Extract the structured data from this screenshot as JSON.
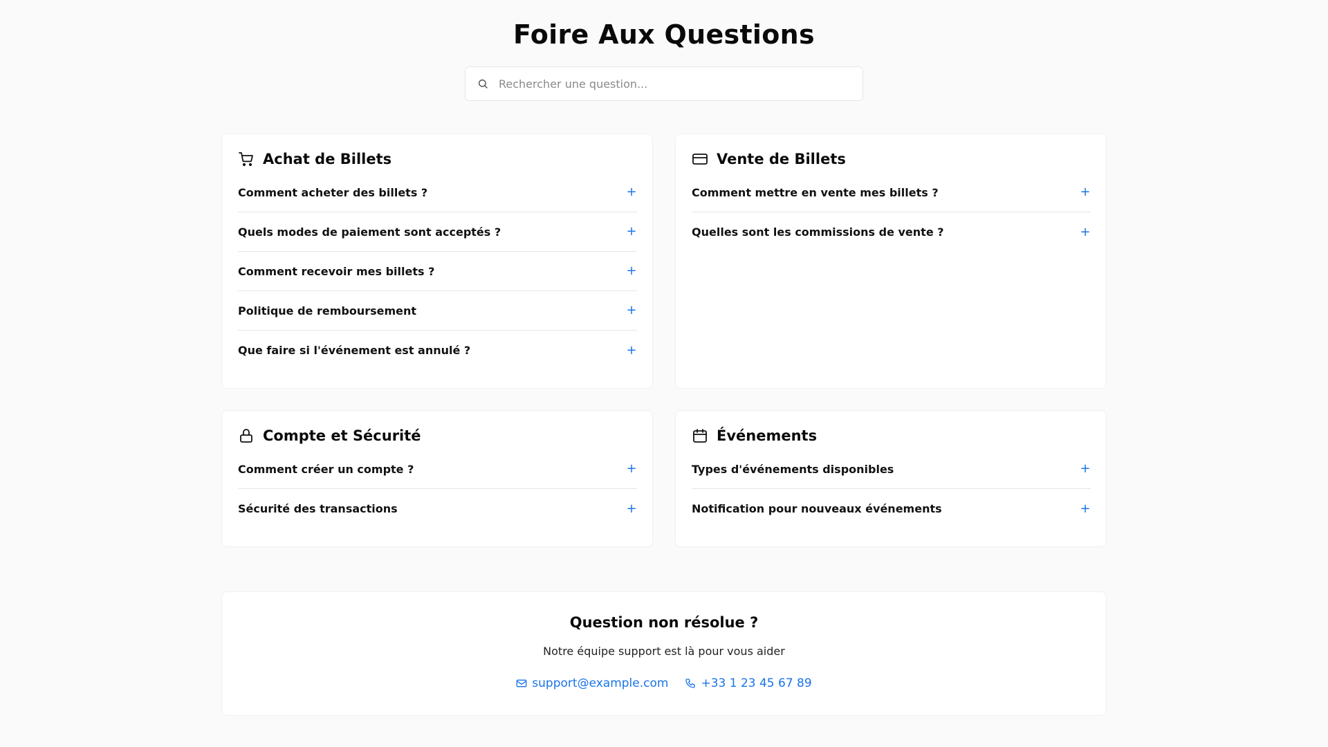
{
  "page": {
    "title": "Foire Aux Questions"
  },
  "search": {
    "placeholder": "Rechercher une question...",
    "icon": "search-icon"
  },
  "accent_color": "#1a73e8",
  "sections": [
    {
      "title": "Achat de Billets",
      "icon": "shopping-cart-icon",
      "questions": [
        "Comment acheter des billets ?",
        "Quels modes de paiement sont acceptés ?",
        "Comment recevoir mes billets ?",
        "Politique de remboursement",
        "Que faire si l'événement est annulé ?"
      ]
    },
    {
      "title": "Vente de Billets",
      "icon": "credit-card-icon",
      "questions": [
        "Comment mettre en vente mes billets ?",
        "Quelles sont les commissions de vente ?"
      ]
    },
    {
      "title": "Compte et Sécurité",
      "icon": "lock-icon",
      "questions": [
        "Comment créer un compte ?",
        "Sécurité des transactions"
      ]
    },
    {
      "title": "Événements",
      "icon": "calendar-icon",
      "questions": [
        "Types d'événements disponibles",
        "Notification pour nouveaux événements"
      ]
    }
  ],
  "expand_symbol": "+",
  "support": {
    "title": "Question non résolue ?",
    "subtitle": "Notre équipe support est là pour vous aider",
    "email": "support@example.com",
    "phone": "+33 1 23 45 67 89"
  }
}
